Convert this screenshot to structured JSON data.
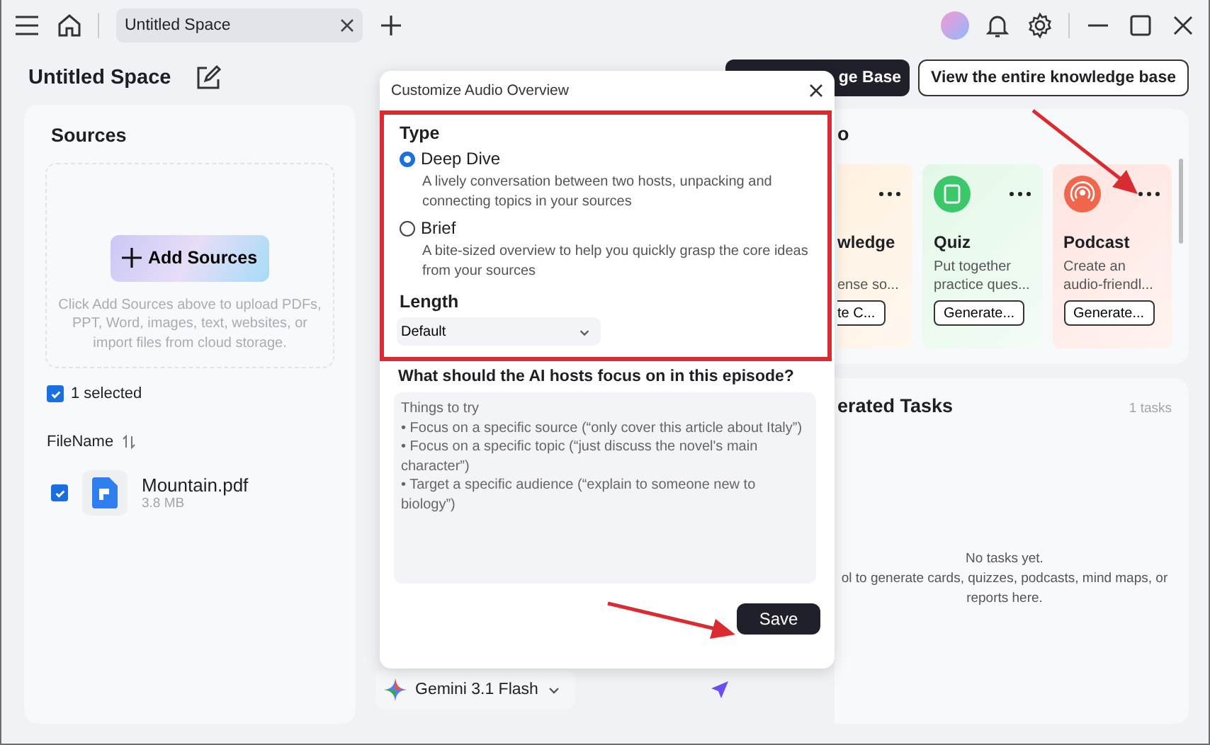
{
  "titlebar": {
    "tab": {
      "title": "Untitled Space"
    }
  },
  "header": {
    "space_title": "Untitled Space",
    "buttons": [
      {
        "label": "ge Base",
        "kind": "primary"
      },
      {
        "label": "View the entire knowledge base",
        "kind": "outline"
      }
    ]
  },
  "sources": {
    "title": "Sources",
    "add_button": "Add Sources",
    "hint": "Click Add Sources above to upload PDFs, PPT, Word, images, text, websites, or import files from cloud storage.",
    "select_all": {
      "label": "1 selected",
      "checked": true
    },
    "sort_label": "FileName",
    "files": [
      {
        "name": "Mountain.pdf",
        "size": "3.8 MB",
        "checked": true
      }
    ]
  },
  "chat": {
    "model": "Gemini 3.1 Flash"
  },
  "studio": {
    "title": "o",
    "tools": [
      {
        "kind": "knowledge",
        "name": "wledge",
        "description": "\nense so...",
        "button": "te C..."
      },
      {
        "kind": "quiz",
        "name": "Quiz",
        "description": "Put together\npractice ques...",
        "button": "Generate..."
      },
      {
        "kind": "podcast",
        "name": "Podcast",
        "description": "Create an\naudio-friendl...",
        "button": "Generate..."
      }
    ]
  },
  "tasks": {
    "title": "erated Tasks",
    "count": "1 tasks",
    "empty_title": "No tasks yet.",
    "empty_hint": "ol to generate cards, quizzes, podcasts, mind maps, or\nreports here."
  },
  "dialog": {
    "title": "Customize Audio Overview",
    "type_label": "Type",
    "types": [
      {
        "label": "Deep Dive",
        "description": "A lively conversation between two hosts, unpacking and connecting topics in your sources",
        "selected": true
      },
      {
        "label": "Brief",
        "description": "A bite-sized overview to help you quickly grasp the core ideas from your sources",
        "selected": false
      }
    ],
    "length_label": "Length",
    "length_value": "Default",
    "focus_label": "What should the AI hosts focus on in this episode?",
    "focus_placeholder": "Things to try\n• Focus on a specific source (“only cover this article about Italy”)\n• Focus on a specific topic (“just discuss the novel's main character”)\n• Target a specific audience (“explain to someone new to biology”)",
    "save": "Save"
  }
}
